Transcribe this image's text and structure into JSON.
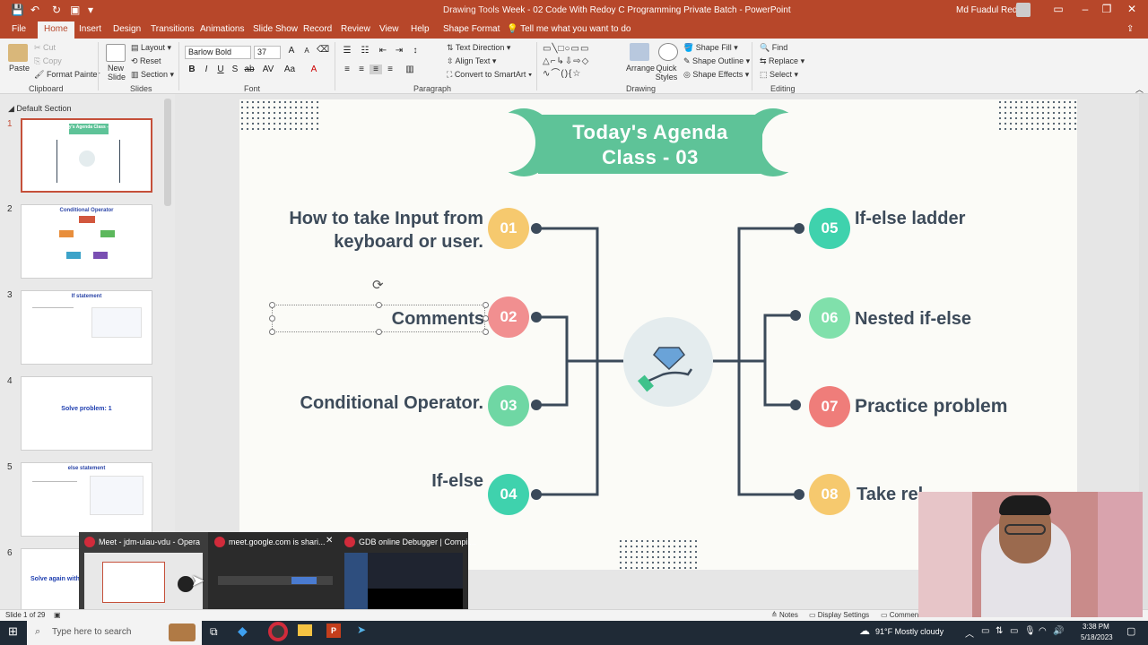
{
  "window": {
    "context_tab": "Drawing Tools",
    "title": "Week - 02 Code With Redoy C Programming Private Batch  -  PowerPoint",
    "user": "Md Fuadul Redoy"
  },
  "tabs": [
    "File",
    "Home",
    "Insert",
    "Design",
    "Transitions",
    "Animations",
    "Slide Show",
    "Record",
    "Review",
    "View",
    "Help",
    "Shape Format"
  ],
  "tell_me": "Tell me what you want to do",
  "ribbon": {
    "clipboard": {
      "paste": "Paste",
      "cut": "Cut",
      "copy": "Copy",
      "format_painter": "Format Painter",
      "label": "Clipboard"
    },
    "slides": {
      "new_slide": "New Slide",
      "layout": "Layout",
      "reset": "Reset",
      "section": "Section",
      "label": "Slides"
    },
    "font": {
      "font_name": "Barlow Bold",
      "font_size": "37",
      "label": "Font"
    },
    "paragraph": {
      "text_direction": "Text Direction",
      "align_text": "Align Text",
      "smartart": "Convert to SmartArt",
      "label": "Paragraph"
    },
    "drawing": {
      "arrange": "Arrange",
      "quick_styles": "Quick Styles",
      "shape_fill": "Shape Fill",
      "shape_outline": "Shape Outline",
      "shape_effects": "Shape Effects",
      "label": "Drawing"
    },
    "editing": {
      "find": "Find",
      "replace": "Replace",
      "select": "Select",
      "label": "Editing"
    }
  },
  "left_panel": {
    "section": "Default Section",
    "slides": [
      {
        "num": "1",
        "title": "Today's Agenda Class - 03"
      },
      {
        "num": "2",
        "title": "Conditional Operator"
      },
      {
        "num": "3",
        "title": "If statement"
      },
      {
        "num": "4",
        "title": "Solve problem: 1"
      },
      {
        "num": "5",
        "title": "else statement"
      },
      {
        "num": "6",
        "title": "Solve again with"
      }
    ]
  },
  "slide": {
    "banner_line1": "Today's Agenda",
    "banner_line2": "Class - 03",
    "left_items": [
      {
        "num": "01",
        "text_line1": "How to take Input from",
        "text_line2": "keyboard or user."
      },
      {
        "num": "02",
        "text": "Comments"
      },
      {
        "num": "03",
        "text": "Conditional Operator."
      },
      {
        "num": "04",
        "text": "If-else"
      }
    ],
    "right_items": [
      {
        "num": "05",
        "text": "If-else ladder"
      },
      {
        "num": "06",
        "text": "Nested if-else"
      },
      {
        "num": "07",
        "text": "Practice problem"
      },
      {
        "num": "08",
        "text": "Take rel"
      }
    ]
  },
  "previews": [
    {
      "title": "Meet - jdm-uiau-vdu - Opera"
    },
    {
      "title": "meet.google.com is shari..."
    },
    {
      "title": "GDB online Debugger | Compil..."
    }
  ],
  "statusbar": {
    "slide_info": "Slide 1 of 29",
    "notes": "Notes",
    "display": "Display Settings",
    "comments": "Comments"
  },
  "taskbar": {
    "search": "Type here to search",
    "weather": "91°F  Mostly cloudy",
    "time": "3:38 PM",
    "date": "5/18/2023"
  },
  "colors": {
    "accent": "#b7472a",
    "banner": "#5ec398",
    "slide_text": "#3d4b5a",
    "connector": "#3b4a5a"
  }
}
